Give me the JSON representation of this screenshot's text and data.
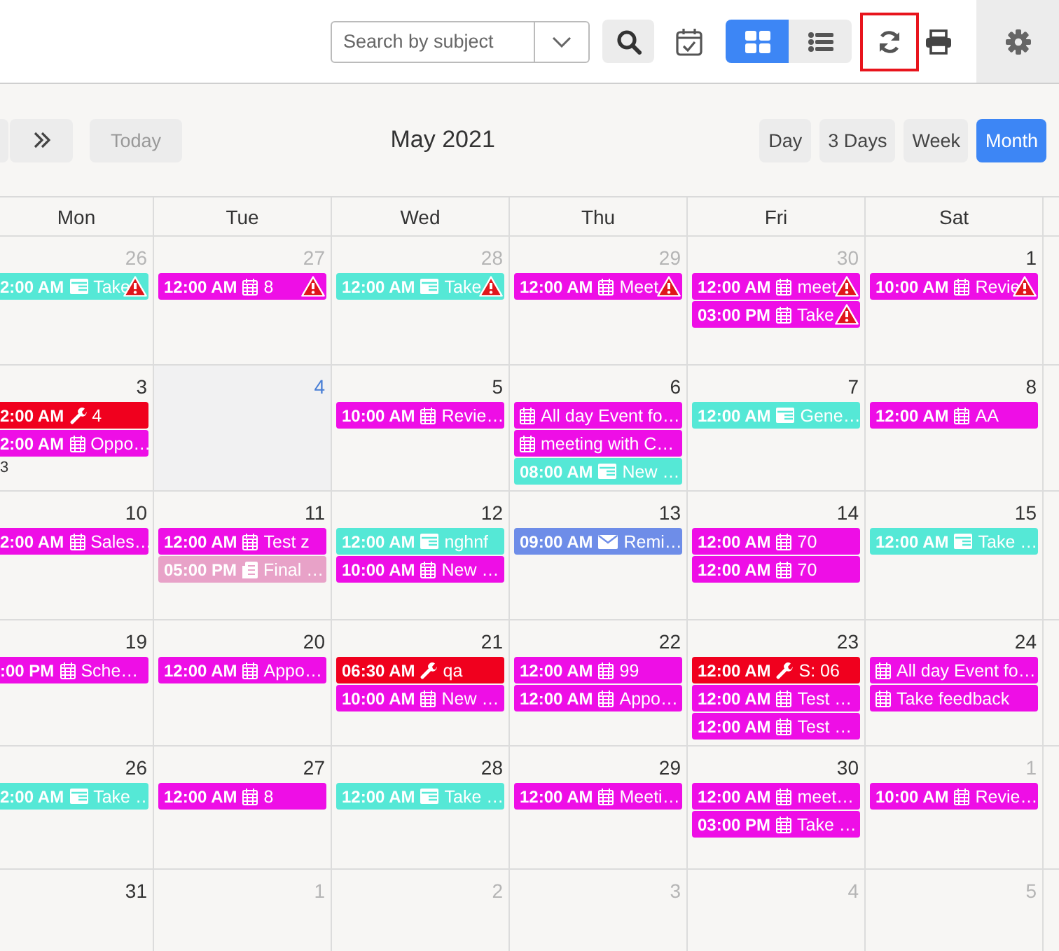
{
  "toolbar": {
    "search": {
      "placeholder": "Search by subject"
    },
    "view_toggle": [
      {
        "kind": "grid",
        "selected": true
      },
      {
        "kind": "list",
        "selected": false
      }
    ],
    "refresh": {
      "highlighted": true
    }
  },
  "nav": {
    "title": "May 2021",
    "today": {
      "label": "Today",
      "disabled": true
    },
    "views": [
      {
        "label": "Day",
        "selected": false
      },
      {
        "label": "3 Days",
        "selected": false
      },
      {
        "label": "Week",
        "selected": false
      },
      {
        "label": "Month",
        "selected": true
      }
    ]
  },
  "calendar": {
    "weekdays": [
      "Mon",
      "Tue",
      "Wed",
      "Thu",
      "Fri",
      "Sat"
    ],
    "weeks": [
      {
        "days": [
          {
            "date": "26",
            "other_month": true,
            "today": false,
            "events": [
              {
                "time": "2:00 AM",
                "kind": "task",
                "title": "Take",
                "warning": true,
                "color": "#55e8d6"
              }
            ]
          },
          {
            "date": "27",
            "other_month": true,
            "today": false,
            "events": [
              {
                "time": "12:00 AM",
                "kind": "meeting",
                "title": "8",
                "warning": true,
                "color": "#ee0ee6"
              }
            ]
          },
          {
            "date": "28",
            "other_month": true,
            "today": false,
            "events": [
              {
                "time": "12:00 AM",
                "kind": "task",
                "title": "Take",
                "warning": true,
                "color": "#55e8d6"
              }
            ]
          },
          {
            "date": "29",
            "other_month": true,
            "today": false,
            "events": [
              {
                "time": "12:00 AM",
                "kind": "meeting",
                "title": "Meet",
                "warning": true,
                "color": "#ee0ee6"
              }
            ]
          },
          {
            "date": "30",
            "other_month": true,
            "today": false,
            "events": [
              {
                "time": "12:00 AM",
                "kind": "meeting",
                "title": "meet",
                "warning": true,
                "color": "#ee0ee6"
              },
              {
                "time": "03:00 PM",
                "kind": "meeting",
                "title": "Take",
                "warning": true,
                "color": "#ee0ee6"
              }
            ]
          },
          {
            "date": "1",
            "other_month": false,
            "today": false,
            "events": [
              {
                "time": "10:00 AM",
                "kind": "meeting",
                "title": "Revie",
                "warning": true,
                "color": "#ee0ee6"
              }
            ]
          }
        ]
      },
      {
        "days": [
          {
            "date": "3",
            "other_month": false,
            "today": false,
            "more": "3",
            "events": [
              {
                "time": "2:00 AM",
                "kind": "repair",
                "title": "4",
                "warning": false,
                "color": "#f0001e"
              },
              {
                "time": "2:00 AM",
                "kind": "meeting",
                "title": "Oppo…",
                "warning": false,
                "color": "#ee0ee6"
              }
            ]
          },
          {
            "date": "4",
            "other_month": false,
            "today": true
          },
          {
            "date": "5",
            "other_month": false,
            "today": false,
            "events": [
              {
                "time": "10:00 AM",
                "kind": "meeting",
                "title": "Revie…",
                "warning": false,
                "color": "#ee0ee6"
              }
            ]
          },
          {
            "date": "6",
            "other_month": false,
            "today": false,
            "events": [
              {
                "kind": "meeting",
                "title": "All day Event fo…",
                "warning": false,
                "color": "#ee0ee6"
              },
              {
                "kind": "meeting",
                "title": "meeting with C…",
                "warning": false,
                "color": "#ee0ee6"
              },
              {
                "time": "08:00 AM",
                "kind": "task",
                "title": "New …",
                "warning": false,
                "color": "#55e8d6"
              }
            ]
          },
          {
            "date": "7",
            "other_month": false,
            "today": false,
            "events": [
              {
                "time": "12:00 AM",
                "kind": "task",
                "title": "Gene…",
                "warning": false,
                "color": "#55e8d6"
              }
            ]
          },
          {
            "date": "8",
            "other_month": false,
            "today": false,
            "events": [
              {
                "time": "12:00 AM",
                "kind": "meeting",
                "title": "AA",
                "warning": false,
                "color": "#ee0ee6"
              }
            ]
          }
        ]
      },
      {
        "days": [
          {
            "date": "10",
            "other_month": false,
            "today": false,
            "events": [
              {
                "time": "2:00 AM",
                "kind": "meeting",
                "title": "Sales…",
                "warning": false,
                "color": "#ee0ee6"
              }
            ]
          },
          {
            "date": "11",
            "other_month": false,
            "today": false,
            "events": [
              {
                "time": "12:00 AM",
                "kind": "meeting",
                "title": "Test z",
                "warning": false,
                "color": "#ee0ee6"
              },
              {
                "time": "05:00 PM",
                "kind": "document",
                "title": "Final …",
                "warning": false,
                "color": "#e8a2c8"
              }
            ]
          },
          {
            "date": "12",
            "other_month": false,
            "today": false,
            "events": [
              {
                "time": "12:00 AM",
                "kind": "task",
                "title": "nghnf",
                "warning": false,
                "color": "#55e8d6"
              },
              {
                "time": "10:00 AM",
                "kind": "meeting",
                "title": "New …",
                "warning": false,
                "color": "#ee0ee6"
              }
            ]
          },
          {
            "date": "13",
            "other_month": false,
            "today": false,
            "events": [
              {
                "time": "09:00 AM",
                "kind": "email",
                "title": "Remi…",
                "warning": false,
                "color": "#6e8de8"
              }
            ]
          },
          {
            "date": "14",
            "other_month": false,
            "today": false,
            "events": [
              {
                "time": "12:00 AM",
                "kind": "meeting",
                "title": "70",
                "warning": false,
                "color": "#ee0ee6"
              },
              {
                "time": "12:00 AM",
                "kind": "meeting",
                "title": "70",
                "warning": false,
                "color": "#ee0ee6"
              }
            ]
          },
          {
            "date": "15",
            "other_month": false,
            "today": false,
            "events": [
              {
                "time": "12:00 AM",
                "kind": "task",
                "title": "Take …",
                "warning": false,
                "color": "#55e8d6"
              }
            ]
          }
        ]
      },
      {
        "days": [
          {
            "date": "19",
            "other_month": false,
            "today": false,
            "events": [
              {
                "time": ":00 PM",
                "kind": "meeting",
                "title": "Sche…",
                "warning": false,
                "color": "#ee0ee6"
              }
            ]
          },
          {
            "date": "20",
            "other_month": false,
            "today": false,
            "events": [
              {
                "time": "12:00 AM",
                "kind": "meeting",
                "title": "Appo…",
                "warning": false,
                "color": "#ee0ee6"
              }
            ]
          },
          {
            "date": "21",
            "other_month": false,
            "today": false,
            "events": [
              {
                "time": "06:30 AM",
                "kind": "repair",
                "title": "qa",
                "warning": false,
                "color": "#f0001e"
              },
              {
                "time": "10:00 AM",
                "kind": "meeting",
                "title": "New …",
                "warning": false,
                "color": "#ee0ee6"
              }
            ]
          },
          {
            "date": "22",
            "other_month": false,
            "today": false,
            "events": [
              {
                "time": "12:00 AM",
                "kind": "meeting",
                "title": "99",
                "warning": false,
                "color": "#ee0ee6"
              },
              {
                "time": "12:00 AM",
                "kind": "meeting",
                "title": "Appo…",
                "warning": false,
                "color": "#ee0ee6"
              }
            ]
          },
          {
            "date": "23",
            "other_month": false,
            "today": false,
            "events": [
              {
                "time": "12:00 AM",
                "kind": "repair",
                "title": "S: 06",
                "warning": false,
                "color": "#f0001e"
              },
              {
                "time": "12:00 AM",
                "kind": "meeting",
                "title": "Test …",
                "warning": false,
                "color": "#ee0ee6"
              },
              {
                "time": "12:00 AM",
                "kind": "meeting",
                "title": "Test …",
                "warning": false,
                "color": "#ee0ee6"
              }
            ]
          },
          {
            "date": "24",
            "other_month": false,
            "today": false,
            "events": [
              {
                "kind": "meeting",
                "title": "All day Event fo…",
                "warning": false,
                "color": "#ee0ee6"
              },
              {
                "kind": "meeting",
                "title": "Take feedback",
                "warning": false,
                "color": "#ee0ee6"
              }
            ]
          }
        ]
      },
      {
        "days": [
          {
            "date": "26",
            "other_month": false,
            "today": false,
            "events": [
              {
                "time": "2:00 AM",
                "kind": "task",
                "title": "Take …",
                "warning": false,
                "color": "#55e8d6"
              }
            ]
          },
          {
            "date": "27",
            "other_month": false,
            "today": false,
            "events": [
              {
                "time": "12:00 AM",
                "kind": "meeting",
                "title": "8",
                "warning": false,
                "color": "#ee0ee6"
              }
            ]
          },
          {
            "date": "28",
            "other_month": false,
            "today": false,
            "events": [
              {
                "time": "12:00 AM",
                "kind": "task",
                "title": "Take …",
                "warning": false,
                "color": "#55e8d6"
              }
            ]
          },
          {
            "date": "29",
            "other_month": false,
            "today": false,
            "events": [
              {
                "time": "12:00 AM",
                "kind": "meeting",
                "title": "Meeti…",
                "warning": false,
                "color": "#ee0ee6"
              }
            ]
          },
          {
            "date": "30",
            "other_month": false,
            "today": false,
            "events": [
              {
                "time": "12:00 AM",
                "kind": "meeting",
                "title": "meet…",
                "warning": false,
                "color": "#ee0ee6"
              },
              {
                "time": "03:00 PM",
                "kind": "meeting",
                "title": "Take …",
                "warning": false,
                "color": "#ee0ee6"
              }
            ]
          },
          {
            "date": "1",
            "other_month": true,
            "today": false,
            "events": [
              {
                "time": "10:00 AM",
                "kind": "meeting",
                "title": "Revie…",
                "warning": false,
                "color": "#ee0ee6"
              }
            ]
          }
        ]
      },
      {
        "days": [
          {
            "date": "31",
            "other_month": false,
            "today": false
          },
          {
            "date": "1",
            "other_month": true,
            "today": false
          },
          {
            "date": "2",
            "other_month": true,
            "today": false
          },
          {
            "date": "3",
            "other_month": true,
            "today": false
          },
          {
            "date": "4",
            "other_month": true,
            "today": false
          },
          {
            "date": "5",
            "other_month": true,
            "today": false
          }
        ]
      }
    ]
  }
}
